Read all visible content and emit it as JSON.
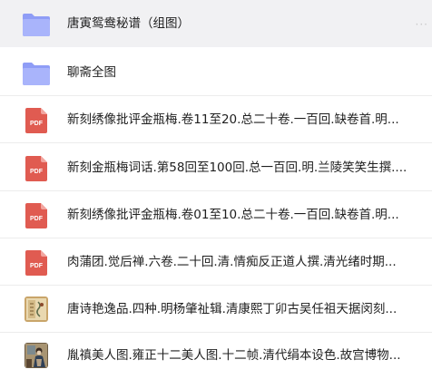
{
  "files": [
    {
      "name": "唐寅鸳鸯秘谱（组图）",
      "type": "folder",
      "icon": "folder-icon",
      "selected": true,
      "more": "···"
    },
    {
      "name": "聊斋全图",
      "type": "folder",
      "icon": "folder-icon"
    },
    {
      "name": "新刻绣像批评金瓶梅.卷11至20.总二十卷.一百回.缺卷首.明...",
      "type": "pdf",
      "icon": "pdf-icon",
      "badge": "PDF"
    },
    {
      "name": "新刻金瓶梅词话.第58回至100回.总一百回.明.兰陵笑笑生撰....",
      "type": "pdf",
      "icon": "pdf-icon",
      "badge": "PDF"
    },
    {
      "name": "新刻绣像批评金瓶梅.卷01至10.总二十卷.一百回.缺卷首.明...",
      "type": "pdf",
      "icon": "pdf-icon",
      "badge": "PDF"
    },
    {
      "name": "肉蒲团.觉后禅.六卷.二十回.清.情痴反正道人撰.清光绪时期...",
      "type": "pdf",
      "icon": "pdf-icon",
      "badge": "PDF"
    },
    {
      "name": "唐诗艳逸品.四种.明杨肇祉辑.清康熙丁卯古吴任祖天据闵刻...",
      "type": "image",
      "icon": "book-thumbnail-icon"
    },
    {
      "name": "胤禛美人图.雍正十二美人图.十二帧.清代绢本设色.故宫博物...",
      "type": "image",
      "icon": "painting-thumbnail-icon"
    }
  ],
  "colors": {
    "folder_back": "#8f9df6",
    "folder_front": "#a9b4fb",
    "pdf_red": "#e05b51",
    "pdf_fold": "#f2a59f",
    "selected_bg": "#f1f1f3"
  }
}
